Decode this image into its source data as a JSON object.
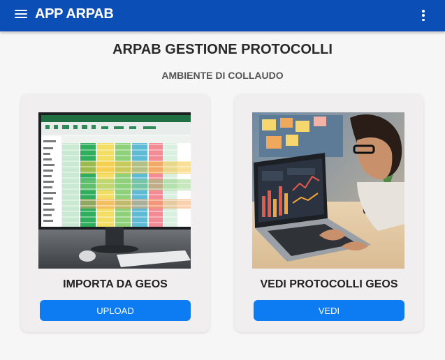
{
  "appbar": {
    "title": "APP ARPAB",
    "menu_icon": "hamburger-menu-icon",
    "more_icon": "more-vertical-icon",
    "color": "#0b4eb6"
  },
  "page": {
    "title": "ARPAB GESTIONE PROTOCOLLI",
    "subtitle": "AMBIENTE DI COLLAUDO"
  },
  "cards": [
    {
      "title": "IMPORTA DA GEOS",
      "button_label": "UPLOAD",
      "image": "spreadsheet-monitor-illustration"
    },
    {
      "title": "VEDI PROTOCOLLI GEOS",
      "button_label": "VEDI",
      "image": "person-laptop-dashboard-illustration"
    }
  ],
  "colors": {
    "accent": "#0d7cf2",
    "background": "#f7f6f6",
    "card": "#f0eeee"
  }
}
